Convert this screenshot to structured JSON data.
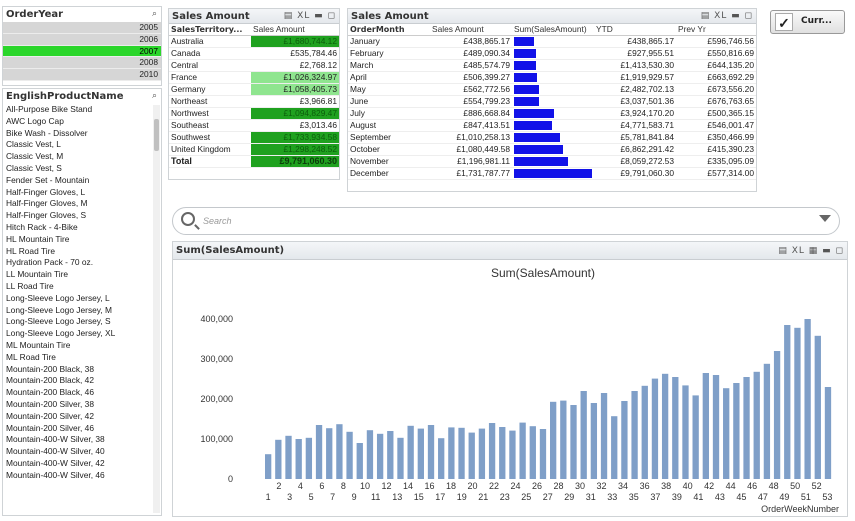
{
  "year_box": {
    "title": "OrderYear",
    "years": [
      "2005",
      "2006",
      "2007",
      "2008",
      "2010"
    ],
    "selected": "2007"
  },
  "product_box": {
    "title": "EnglishProductName",
    "items": [
      "All-Purpose Bike Stand",
      "AWC Logo Cap",
      "Bike Wash - Dissolver",
      "Classic Vest, L",
      "Classic Vest, M",
      "Classic Vest, S",
      "Fender Set - Mountain",
      "Half-Finger Gloves, L",
      "Half-Finger Gloves, M",
      "Half-Finger Gloves, S",
      "Hitch Rack - 4-Bike",
      "HL Mountain Tire",
      "HL Road Tire",
      "Hydration Pack - 70 oz.",
      "LL Mountain Tire",
      "LL Road Tire",
      "Long-Sleeve Logo Jersey, L",
      "Long-Sleeve Logo Jersey, M",
      "Long-Sleeve Logo Jersey, S",
      "Long-Sleeve Logo Jersey, XL",
      "ML Mountain Tire",
      "ML Road Tire",
      "Mountain-200 Black, 38",
      "Mountain-200 Black, 42",
      "Mountain-200 Black, 46",
      "Mountain-200 Silver, 38",
      "Mountain-200 Silver, 42",
      "Mountain-200 Silver, 46",
      "Mountain-400-W Silver, 38",
      "Mountain-400-W Silver, 40",
      "Mountain-400-W Silver, 42",
      "Mountain-400-W Silver, 46"
    ]
  },
  "territory_table": {
    "title": "Sales Amount",
    "col1": "SalesTerritory...",
    "col2": "Sales Amount",
    "rows": [
      {
        "name": "Australia",
        "value": "£1,680,744.12",
        "shade": "dark"
      },
      {
        "name": "Canada",
        "value": "£535,784.46",
        "shade": "none"
      },
      {
        "name": "Central",
        "value": "£2,768.12",
        "shade": "none"
      },
      {
        "name": "France",
        "value": "£1,026,324.97",
        "shade": "light"
      },
      {
        "name": "Germany",
        "value": "£1,058,405.73",
        "shade": "light"
      },
      {
        "name": "Northeast",
        "value": "£3,966.81",
        "shade": "none"
      },
      {
        "name": "Northwest",
        "value": "£1,094,829.47",
        "shade": "dark"
      },
      {
        "name": "Southeast",
        "value": "£3,013.46",
        "shade": "none"
      },
      {
        "name": "Southwest",
        "value": "£1,733,934.58",
        "shade": "dark"
      },
      {
        "name": "United Kingdom",
        "value": "£1,298,248.52",
        "shade": "dark"
      }
    ],
    "total_label": "Total",
    "total_value": "£9,791,060.30"
  },
  "month_table": {
    "title": "Sales Amount",
    "headers": [
      "OrderMonth",
      "Sales Amount",
      "Sum(SalesAmount)",
      "YTD",
      "Prev Yr"
    ],
    "rows": [
      {
        "month": "January",
        "sales": "£438,865.17",
        "bar": 438865.17,
        "ytd": "£438,865.17",
        "prev": "£596,746.56"
      },
      {
        "month": "February",
        "sales": "£489,090.34",
        "bar": 489090.34,
        "ytd": "£927,955.51",
        "prev": "£550,816.69"
      },
      {
        "month": "March",
        "sales": "£485,574.79",
        "bar": 485574.79,
        "ytd": "£1,413,530.30",
        "prev": "£644,135.20"
      },
      {
        "month": "April",
        "sales": "£506,399.27",
        "bar": 506399.27,
        "ytd": "£1,919,929.57",
        "prev": "£663,692.29"
      },
      {
        "month": "May",
        "sales": "£562,772.56",
        "bar": 562772.56,
        "ytd": "£2,482,702.13",
        "prev": "£673,556.20"
      },
      {
        "month": "June",
        "sales": "£554,799.23",
        "bar": 554799.23,
        "ytd": "£3,037,501.36",
        "prev": "£676,763.65"
      },
      {
        "month": "July",
        "sales": "£886,668.84",
        "bar": 886668.84,
        "ytd": "£3,924,170.20",
        "prev": "£500,365.15"
      },
      {
        "month": "August",
        "sales": "£847,413.51",
        "bar": 847413.51,
        "ytd": "£4,771,583.71",
        "prev": "£546,001.47"
      },
      {
        "month": "September",
        "sales": "£1,010,258.13",
        "bar": 1010258.13,
        "ytd": "£5,781,841.84",
        "prev": "£350,466.99"
      },
      {
        "month": "October",
        "sales": "£1,080,449.58",
        "bar": 1080449.58,
        "ytd": "£6,862,291.42",
        "prev": "£415,390.23"
      },
      {
        "month": "November",
        "sales": "£1,196,981.11",
        "bar": 1196981.11,
        "ytd": "£8,059,272.53",
        "prev": "£335,095.09"
      },
      {
        "month": "December",
        "sales": "£1,731,787.77",
        "bar": 1731787.77,
        "ytd": "£9,791,060.30",
        "prev": "£577,314.00"
      }
    ],
    "bar_max": 1731787.77,
    "bar_color": "#1212e8"
  },
  "current_button": {
    "label": "Curr..."
  },
  "search": {
    "placeholder": "Search"
  },
  "chart_box": {
    "caption": "Sum(SalesAmount)"
  },
  "chart_data": {
    "type": "bar",
    "title": "Sum(SalesAmount)",
    "xlabel": "OrderWeekNumber",
    "ylabel": "",
    "ylim": [
      0,
      420000
    ],
    "yticks": [
      0,
      100000,
      200000,
      300000,
      400000
    ],
    "ytick_labels": [
      "0",
      "100,000",
      "200,000",
      "300,000",
      "400,000"
    ],
    "bar_color": "#7f9fc8",
    "categories": [
      1,
      2,
      3,
      4,
      5,
      6,
      7,
      8,
      9,
      10,
      11,
      12,
      13,
      14,
      15,
      16,
      17,
      18,
      19,
      20,
      21,
      22,
      23,
      24,
      25,
      26,
      27,
      28,
      29,
      30,
      31,
      32,
      33,
      34,
      35,
      36,
      37,
      38,
      39,
      40,
      41,
      42,
      43,
      44,
      45,
      46,
      47,
      48,
      49,
      50,
      51,
      52,
      53
    ],
    "values": [
      62000,
      98000,
      108000,
      100000,
      103000,
      135000,
      127000,
      137000,
      118000,
      90000,
      122000,
      113000,
      120000,
      103000,
      133000,
      126000,
      135000,
      102000,
      129000,
      128000,
      116000,
      126000,
      140000,
      130000,
      121000,
      141000,
      132000,
      125000,
      193000,
      196000,
      185000,
      220000,
      190000,
      215000,
      157000,
      195000,
      220000,
      233000,
      251000,
      263000,
      255000,
      234000,
      209000,
      265000,
      260000,
      227000,
      240000,
      255000,
      268000,
      288000,
      320000,
      385000,
      378000,
      400000,
      358000,
      230000
    ]
  }
}
